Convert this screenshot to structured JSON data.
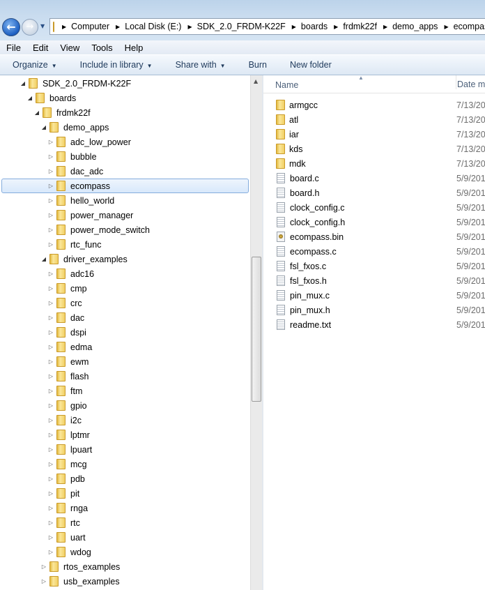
{
  "address_bar": {
    "crumbs": [
      "Computer",
      "Local Disk (E:)",
      "SDK_2.0_FRDM-K22F",
      "boards",
      "frdmk22f",
      "demo_apps",
      "ecompass"
    ]
  },
  "menu": [
    "File",
    "Edit",
    "View",
    "Tools",
    "Help"
  ],
  "toolbar": {
    "organize": "Organize",
    "include": "Include in library",
    "share": "Share with",
    "burn": "Burn",
    "new_folder": "New folder"
  },
  "tree": [
    {
      "label": "SDK_2.0_FRDM-K22F",
      "level": 0,
      "expanded": true
    },
    {
      "label": "boards",
      "level": 1,
      "expanded": true
    },
    {
      "label": "frdmk22f",
      "level": 2,
      "expanded": true
    },
    {
      "label": "demo_apps",
      "level": 3,
      "expanded": true
    },
    {
      "label": "adc_low_power",
      "level": 4
    },
    {
      "label": "bubble",
      "level": 4
    },
    {
      "label": "dac_adc",
      "level": 4
    },
    {
      "label": "ecompass",
      "level": 4,
      "selected": true
    },
    {
      "label": "hello_world",
      "level": 4
    },
    {
      "label": "power_manager",
      "level": 4
    },
    {
      "label": "power_mode_switch",
      "level": 4
    },
    {
      "label": "rtc_func",
      "level": 4
    },
    {
      "label": "driver_examples",
      "level": 3,
      "expanded": true
    },
    {
      "label": "adc16",
      "level": 4
    },
    {
      "label": "cmp",
      "level": 4
    },
    {
      "label": "crc",
      "level": 4
    },
    {
      "label": "dac",
      "level": 4
    },
    {
      "label": "dspi",
      "level": 4
    },
    {
      "label": "edma",
      "level": 4
    },
    {
      "label": "ewm",
      "level": 4
    },
    {
      "label": "flash",
      "level": 4
    },
    {
      "label": "ftm",
      "level": 4
    },
    {
      "label": "gpio",
      "level": 4
    },
    {
      "label": "i2c",
      "level": 4
    },
    {
      "label": "lptmr",
      "level": 4
    },
    {
      "label": "lpuart",
      "level": 4
    },
    {
      "label": "mcg",
      "level": 4
    },
    {
      "label": "pdb",
      "level": 4
    },
    {
      "label": "pit",
      "level": 4
    },
    {
      "label": "rnga",
      "level": 4
    },
    {
      "label": "rtc",
      "level": 4
    },
    {
      "label": "uart",
      "level": 4
    },
    {
      "label": "wdog",
      "level": 4
    },
    {
      "label": "rtos_examples",
      "level": 3
    },
    {
      "label": "usb_examples",
      "level": 3
    }
  ],
  "columns": {
    "name": "Name",
    "date": "Date mo"
  },
  "files": [
    {
      "name": "armgcc",
      "type": "folder",
      "date": "7/13/20"
    },
    {
      "name": "atl",
      "type": "folder",
      "date": "7/13/20"
    },
    {
      "name": "iar",
      "type": "folder",
      "date": "7/13/20"
    },
    {
      "name": "kds",
      "type": "folder",
      "date": "7/13/20"
    },
    {
      "name": "mdk",
      "type": "folder",
      "date": "7/13/20"
    },
    {
      "name": "board.c",
      "type": "doc",
      "date": "5/9/201"
    },
    {
      "name": "board.h",
      "type": "doc",
      "date": "5/9/201"
    },
    {
      "name": "clock_config.c",
      "type": "doc",
      "date": "5/9/201"
    },
    {
      "name": "clock_config.h",
      "type": "doc",
      "date": "5/9/201"
    },
    {
      "name": "ecompass.bin",
      "type": "bin",
      "date": "5/9/201"
    },
    {
      "name": "ecompass.c",
      "type": "doc",
      "date": "5/9/201"
    },
    {
      "name": "fsl_fxos.c",
      "type": "doc",
      "date": "5/9/201"
    },
    {
      "name": "fsl_fxos.h",
      "type": "doc",
      "date": "5/9/201"
    },
    {
      "name": "pin_mux.c",
      "type": "doc",
      "date": "5/9/201"
    },
    {
      "name": "pin_mux.h",
      "type": "doc",
      "date": "5/9/201"
    },
    {
      "name": "readme.txt",
      "type": "doc",
      "date": "5/9/201"
    }
  ]
}
